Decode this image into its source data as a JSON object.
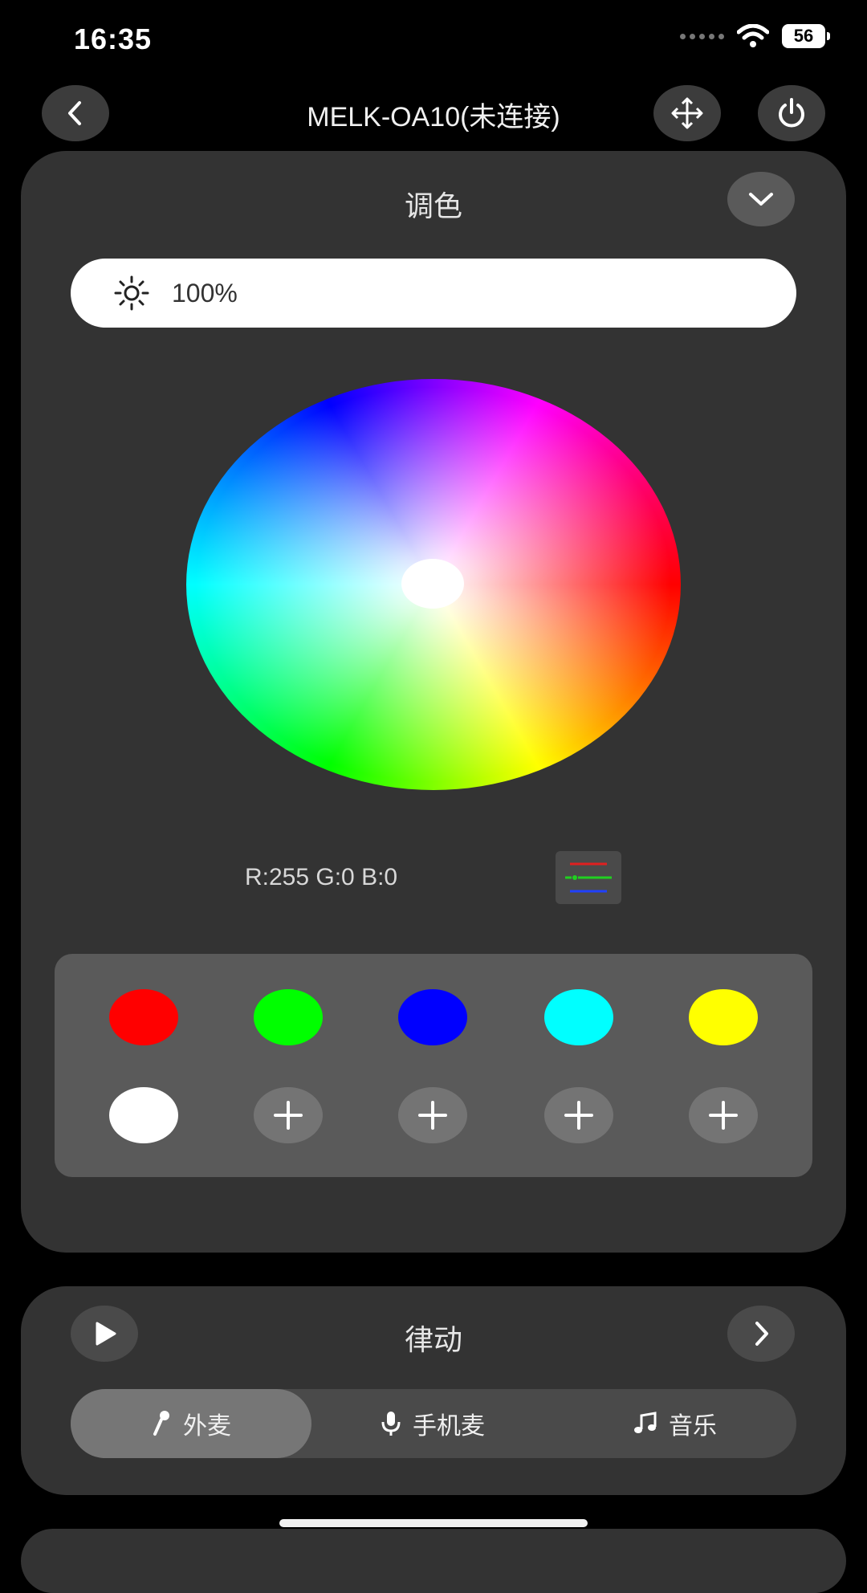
{
  "status_bar": {
    "time": "16:35",
    "battery": "56"
  },
  "header": {
    "title": "MELK-OA10(未连接)",
    "back_icon": "chevron-left-icon",
    "move_icon": "move-arrows-icon",
    "power_icon": "power-icon"
  },
  "color_panel": {
    "title": "调色",
    "collapse_icon": "chevron-down-icon",
    "brightness": {
      "icon": "sun-icon",
      "value": "100%"
    },
    "rgb_readout": "R:255 G:0 B:0",
    "rgb_mode_icon": "rgb-sliders-icon",
    "swatches": [
      {
        "color": "#ff0000"
      },
      {
        "color": "#00ff00"
      },
      {
        "color": "#0000ff"
      },
      {
        "color": "#00ffff"
      },
      {
        "color": "#ffff00"
      },
      {
        "color": "#ffffff"
      }
    ],
    "add_slot_icon": "plus-icon"
  },
  "rhythm_panel": {
    "title": "律动",
    "play_icon": "play-icon",
    "next_icon": "chevron-right-icon",
    "tabs": [
      {
        "label": "外麦",
        "icon": "external-mic-icon",
        "active": true
      },
      {
        "label": "手机麦",
        "icon": "phone-mic-icon",
        "active": false
      },
      {
        "label": "音乐",
        "icon": "music-note-icon",
        "active": false
      }
    ]
  }
}
